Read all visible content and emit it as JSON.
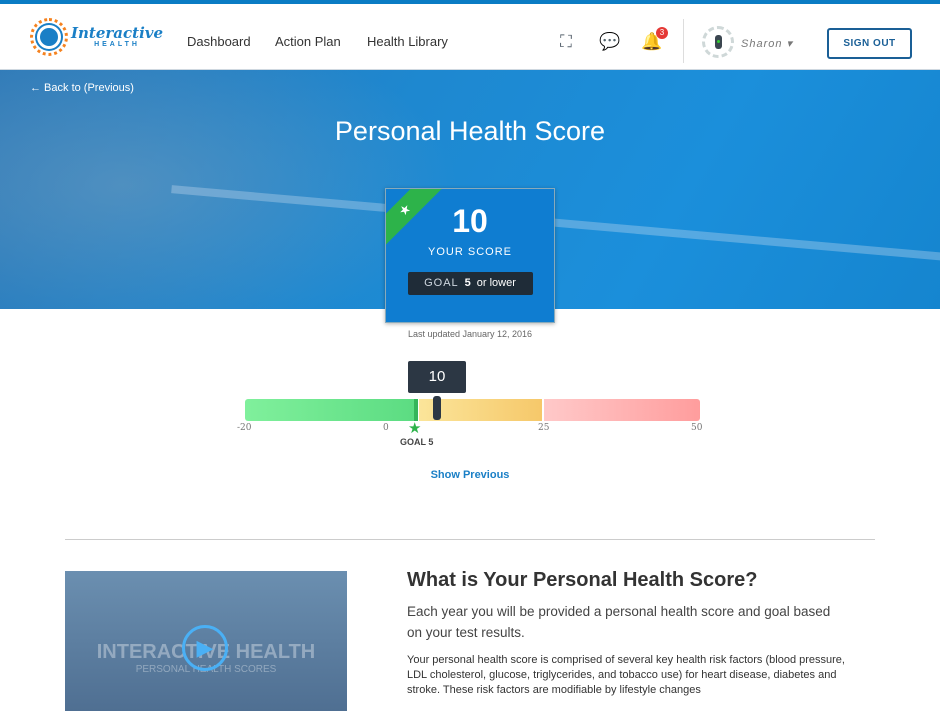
{
  "header": {
    "logo_top": "Interactive",
    "logo_bottom": "HEALTH",
    "nav": [
      "Dashboard",
      "Action Plan",
      "Health Library"
    ],
    "notification_count": "3",
    "user": "Sharon",
    "sign_out": "SIGN OUT"
  },
  "hero": {
    "back": "← Back to (Previous)",
    "title": "Personal Health Score"
  },
  "score_card": {
    "score": "10",
    "label": "YOUR SCORE",
    "goal_label": "GOAL",
    "goal_value": "5",
    "goal_suffix": "or lower",
    "updated": "Last updated January 12, 2016"
  },
  "scale": {
    "current": "10",
    "current_value": 10,
    "goal_value": 5,
    "ticks": [
      "-20",
      "0",
      "25",
      "50"
    ],
    "goal_label": "GOAL 5",
    "zones": [
      {
        "from": -20,
        "to": 5,
        "color": "#6ee68c"
      },
      {
        "from": 5,
        "to": 25,
        "color": "#f8d77a"
      },
      {
        "from": 25,
        "to": 50,
        "color": "#ffb3b3"
      }
    ]
  },
  "show_previous": "Show Previous",
  "video": {
    "title": "INTERACTIVE HEALTH",
    "subtitle": "PERSONAL HEALTH SCORES"
  },
  "info": {
    "heading": "What is Your Personal Health Score?",
    "intro": "Each year you will be provided a personal health score and goal based on your test results.",
    "body": "Your personal health score is comprised of several key health risk factors (blood pressure, LDL cholesterol, glucose, triglycerides, and tobacco use) for heart disease, diabetes and stroke. These risk factors are modifiable by lifestyle changes"
  }
}
